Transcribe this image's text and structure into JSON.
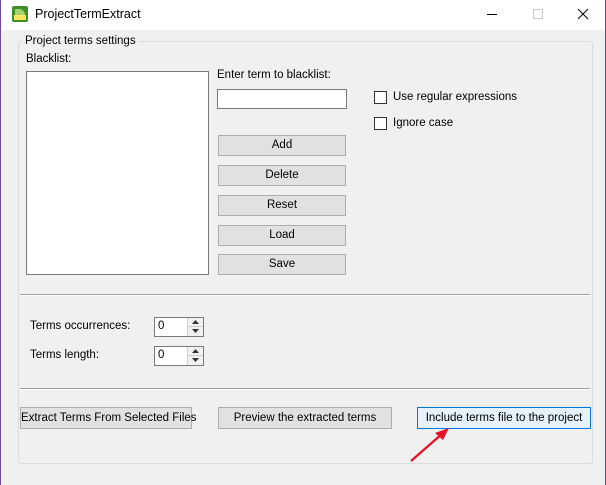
{
  "window": {
    "title": "ProjectTermExtract",
    "icon": "sdl-app-icon",
    "controls": [
      "minimize-icon",
      "maximize-icon",
      "close-icon"
    ]
  },
  "group": {
    "title": "Project terms settings"
  },
  "blacklist": {
    "label": "Blacklist:",
    "items": []
  },
  "term_input": {
    "label": "Enter term to blacklist:",
    "value": ""
  },
  "options": {
    "regex_label": "Use regular expressions",
    "regex_checked": false,
    "ignore_case_label": "Ignore case",
    "ignore_case_checked": false
  },
  "buttons": {
    "add": "Add",
    "delete": "Delete",
    "reset": "Reset",
    "load": "Load",
    "save": "Save"
  },
  "numeric": {
    "occurrences_label": "Terms  occurrences:",
    "occurrences_value": "0",
    "length_label": "Terms length:",
    "length_value": "0"
  },
  "actions": {
    "extract": "Extract Terms From Selected Files",
    "preview": "Preview the extracted terms",
    "include": "Include terms file to the project"
  },
  "annotation": {
    "arrow_color": "#e81123",
    "arrow_icon": "red-arrow-icon"
  },
  "colors": {
    "focus_border": "#0078d7",
    "window_border": "#6b4aa0"
  }
}
